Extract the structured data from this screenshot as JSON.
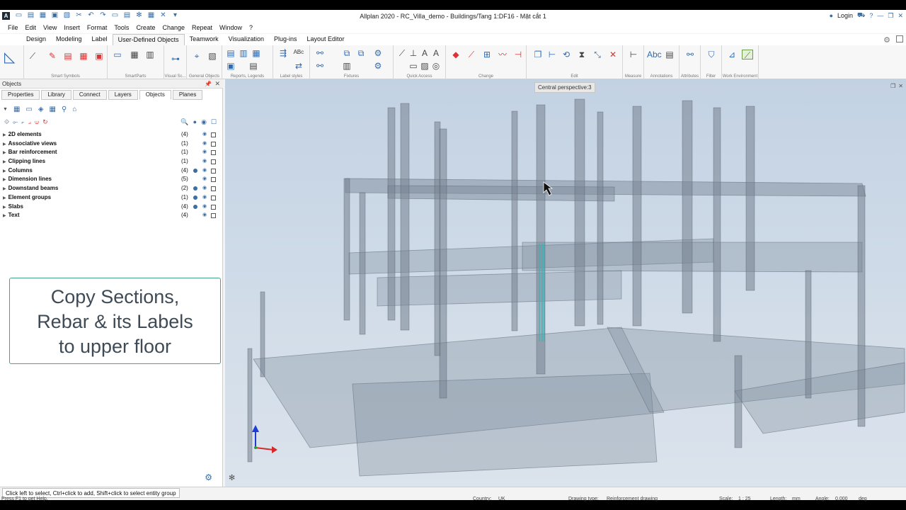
{
  "app": {
    "logo": "A",
    "title": "Allplan 2020 - RC_Villa_demo - Buildings/Tang 1:DF16 - Mặt cắt 1",
    "login_label": "Login"
  },
  "menu": [
    "File",
    "Edit",
    "View",
    "Insert",
    "Format",
    "Tools",
    "Create",
    "Change",
    "Repeat",
    "Window",
    "?"
  ],
  "ribbon_tabs": {
    "items": [
      "Design",
      "Modeling",
      "Label",
      "User-Defined Objects",
      "Teamwork",
      "Visualization",
      "Plug-ins",
      "Layout Editor"
    ],
    "active": "User-Defined Objects"
  },
  "ribbon_groups": [
    "Smart Symbols",
    "SmartParts",
    "Visual Sc...",
    "General Objects",
    "Reports, Legends",
    "Label styles",
    "Fixtures",
    "Quick Access",
    "Change",
    "Edit",
    "Measure",
    "Annotations",
    "Attributes",
    "Filter",
    "Work Environment"
  ],
  "panel": {
    "title": "Objects",
    "tabs": [
      "Properties",
      "Library",
      "Connect",
      "Layers",
      "Objects",
      "Planes"
    ],
    "active_tab": "Objects",
    "items": [
      {
        "label": "2D elements",
        "count": "(4)",
        "dot": false
      },
      {
        "label": "Associative views",
        "count": "(1)",
        "dot": false
      },
      {
        "label": "Bar reinforcement",
        "count": "(1)",
        "dot": false
      },
      {
        "label": "Clipping lines",
        "count": "(1)",
        "dot": false
      },
      {
        "label": "Columns",
        "count": "(4)",
        "dot": true
      },
      {
        "label": "Dimension lines",
        "count": "(5)",
        "dot": false
      },
      {
        "label": "Downstand beams",
        "count": "(2)",
        "dot": true
      },
      {
        "label": "Element groups",
        "count": "(1)",
        "dot": true
      },
      {
        "label": "Slabs",
        "count": "(4)",
        "dot": true
      },
      {
        "label": "Text",
        "count": "(4)",
        "dot": false
      }
    ]
  },
  "callout": {
    "lines": [
      "Copy Sections,",
      "Rebar & its Labels",
      "to upper floor"
    ]
  },
  "viewport": {
    "label": "Central perspective:3"
  },
  "hint": "Click left to select, Ctrl+click to add, Shift+click to select entity group",
  "status": {
    "help": "Press F1 to get Help.",
    "country_label": "Country:",
    "country": "UK",
    "drawing_type_label": "Drawing type:",
    "drawing_type": "Reinforcement drawing",
    "scale_label": "Scale:",
    "scale": "1 : 25",
    "length_label": "Length:",
    "length": "mm",
    "angle_label": "Angle:",
    "angle": "0.000",
    "angle_unit": "deg"
  },
  "colors": {
    "accent": "#45a583",
    "rebar": "#3fb3b8",
    "icon_blue": "#2e6bb5",
    "icon_red": "#d33333"
  }
}
